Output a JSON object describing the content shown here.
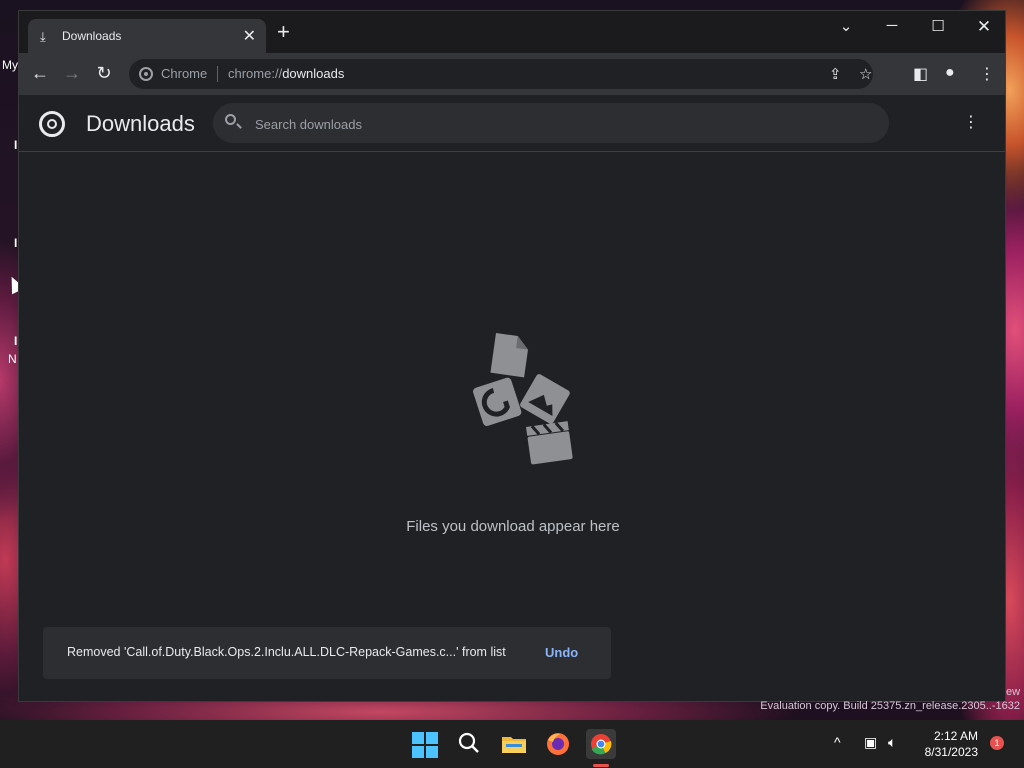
{
  "desktop": {
    "left_labels": [
      "My",
      "I",
      "I",
      "I",
      "N"
    ],
    "watermark_right": "ew",
    "watermark": "Evaluation copy. Build 25375.zn_release.2305..-1632"
  },
  "tab": {
    "title": "Downloads",
    "icon": "download-icon"
  },
  "omnibox": {
    "site_label": "Chrome",
    "url_prefix": "chrome://",
    "url_path": "downloads"
  },
  "downloads_page": {
    "title": "Downloads",
    "search_placeholder": "Search downloads",
    "empty_message": "Files you download appear here"
  },
  "toast": {
    "message": "Removed 'Call.of.Duty.Black.Ops.2.Inclu.ALL.DLC-Repack-Games.c...' from list",
    "action": "Undo"
  },
  "taskbar": {
    "time": "2:12 AM",
    "date": "8/31/2023",
    "notification_count": "1"
  },
  "colors": {
    "accent_link": "#8ab4f8",
    "window_bg": "#202124",
    "toolbar_bg": "#35363a"
  }
}
